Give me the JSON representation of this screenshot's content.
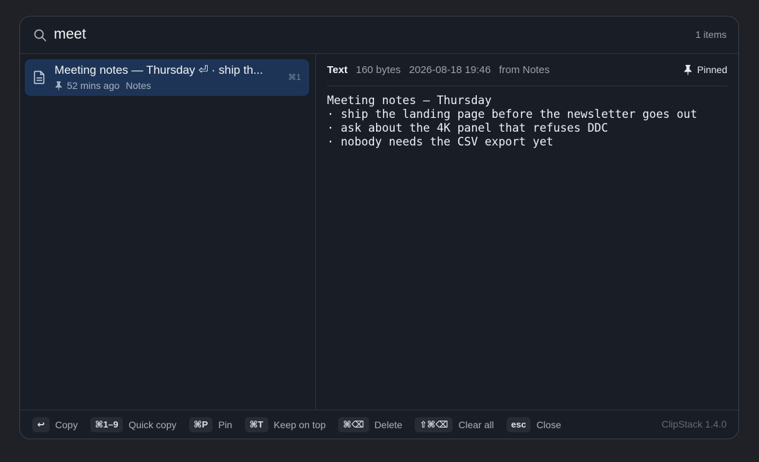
{
  "search": {
    "query": "meet",
    "item_count": "1 items"
  },
  "list": {
    "items": [
      {
        "title": "Meeting notes — Thursday ⏎ · ship th...",
        "time": "52 mins ago",
        "source": "Notes",
        "shortcut": "⌘1",
        "pinned": true,
        "selected": true
      }
    ]
  },
  "detail": {
    "type": "Text",
    "size": "160 bytes",
    "date": "2026-08-18 19:46",
    "source": "from Notes",
    "pinned_label": "Pinned",
    "content": "Meeting notes — Thursday\n· ship the landing page before the newsletter goes out\n· ask about the 4K panel that refuses DDC\n· nobody needs the CSV export yet"
  },
  "footer": {
    "hints": [
      {
        "key": "↩",
        "label": "Copy"
      },
      {
        "key": "⌘1–9",
        "label": "Quick copy"
      },
      {
        "key": "⌘P",
        "label": "Pin"
      },
      {
        "key": "⌘T",
        "label": "Keep on top"
      },
      {
        "key": "⌘⌫",
        "label": "Delete"
      },
      {
        "key": "⇧⌘⌫",
        "label": "Clear all"
      },
      {
        "key": "esc",
        "label": "Close"
      }
    ],
    "version": "ClipStack 1.4.0"
  },
  "colors": {
    "accent": "#3b82f6",
    "selected_row": "#1d3456",
    "panel_bg": "#181d26"
  },
  "icons": {
    "search": "search-icon",
    "item": "document-icon",
    "pin": "pin-icon"
  }
}
